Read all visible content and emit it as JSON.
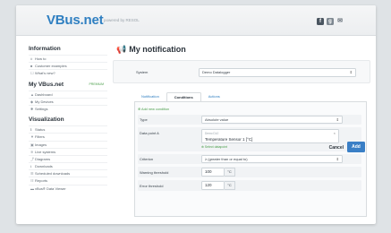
{
  "header": {
    "logo": "VBus.net",
    "logo_sub": "powered by RESOL",
    "icons": [
      "facebook-icon",
      "google-plus-icon",
      "mail-icon"
    ]
  },
  "sidebar": {
    "sections": [
      {
        "title": "Information",
        "tag": "",
        "items": [
          {
            "icon": "#",
            "label": "How to"
          },
          {
            "icon": "■",
            "label": "Customer examples"
          },
          {
            "icon": "☐",
            "label": "What's new?"
          }
        ]
      },
      {
        "title": "My VBus.net",
        "tag": "PREMIUM",
        "items": [
          {
            "icon": "▲",
            "label": "Dashboard"
          },
          {
            "icon": "◆",
            "label": "My Devices"
          },
          {
            "icon": "✱",
            "label": "Settings"
          }
        ]
      },
      {
        "title": "Visualization",
        "tag": "",
        "items": [
          {
            "icon": "ℹ",
            "label": "Status"
          },
          {
            "icon": "▼",
            "label": "Filters"
          },
          {
            "icon": "▣",
            "label": "Images"
          },
          {
            "icon": "≋",
            "label": "Live systems"
          },
          {
            "icon": "⤴",
            "label": "Diagrams"
          },
          {
            "icon": "⭳",
            "label": "Downloads"
          },
          {
            "icon": "☰",
            "label": "Scheduled downloads"
          },
          {
            "icon": "☷",
            "label": "Reports"
          },
          {
            "icon": "▬",
            "label": "vBus® Data Viewer"
          }
        ]
      }
    ]
  },
  "main": {
    "title": "My notification",
    "system_label": "System",
    "system_value": "Demo Datalogger",
    "tabs": [
      "Notification",
      "Conditions",
      "Actions"
    ],
    "active_tab": 1,
    "add_condition": "Add new condition",
    "rows": {
      "type_label": "Type",
      "type_value": "Absolute value",
      "dp_label": "Data point A",
      "dp_small": "Demo DL0",
      "dp_value": "Temperature Sensor 1 [°C]",
      "dp_link": "Select datapoint",
      "criterion_label": "Criterion",
      "criterion_value": "≥ (greater than or equal to)",
      "warning_label": "Warning threshold",
      "warning_value": "100",
      "error_label": "Error threshold",
      "error_value": "120",
      "unit": "°C"
    },
    "cancel_label": "Cancel",
    "add_label": "Add"
  }
}
